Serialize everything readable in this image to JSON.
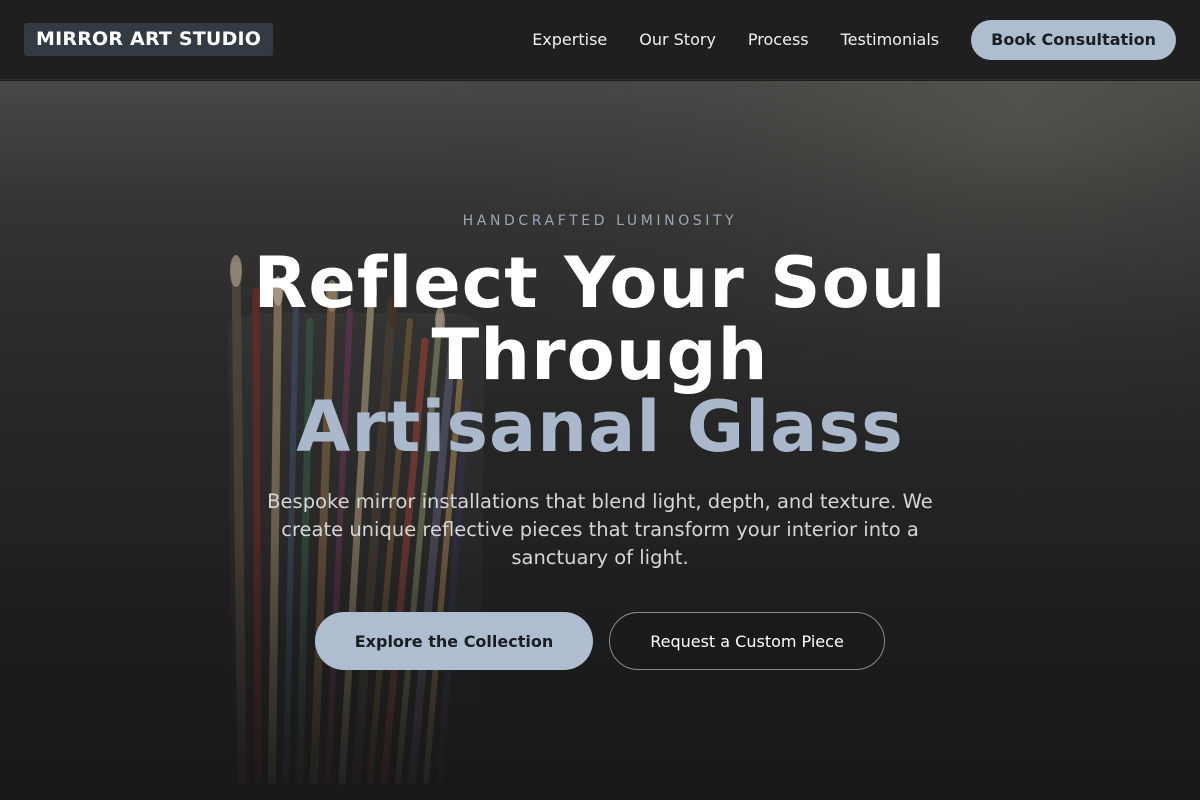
{
  "header": {
    "logo": "MIRROR ART STUDIO",
    "nav": [
      "Expertise",
      "Our Story",
      "Process",
      "Testimonials"
    ],
    "cta": "Book Consultation"
  },
  "hero": {
    "eyebrow": "HANDCRAFTED LUMINOSITY",
    "headline_line1": "Reflect Your Soul",
    "headline_line2": "Through",
    "headline_accent": "Artisanal Glass",
    "subtext": "Bespoke mirror installations that blend light, depth, and texture. We create unique reflective pieces that transform your interior into a sanctuary of light.",
    "primary_cta": "Explore the Collection",
    "secondary_cta": "Request a Custom Piece",
    "background_image": "paintbrushes-in-glass-jar"
  },
  "colors": {
    "header_bg": "#1f1f1f",
    "logo_bg": "#323a43",
    "accent": "#aebdd0",
    "headline_accent": "#a9b8cb",
    "eyebrow": "#9aa8b8",
    "body_text": "#d6d6d6"
  }
}
